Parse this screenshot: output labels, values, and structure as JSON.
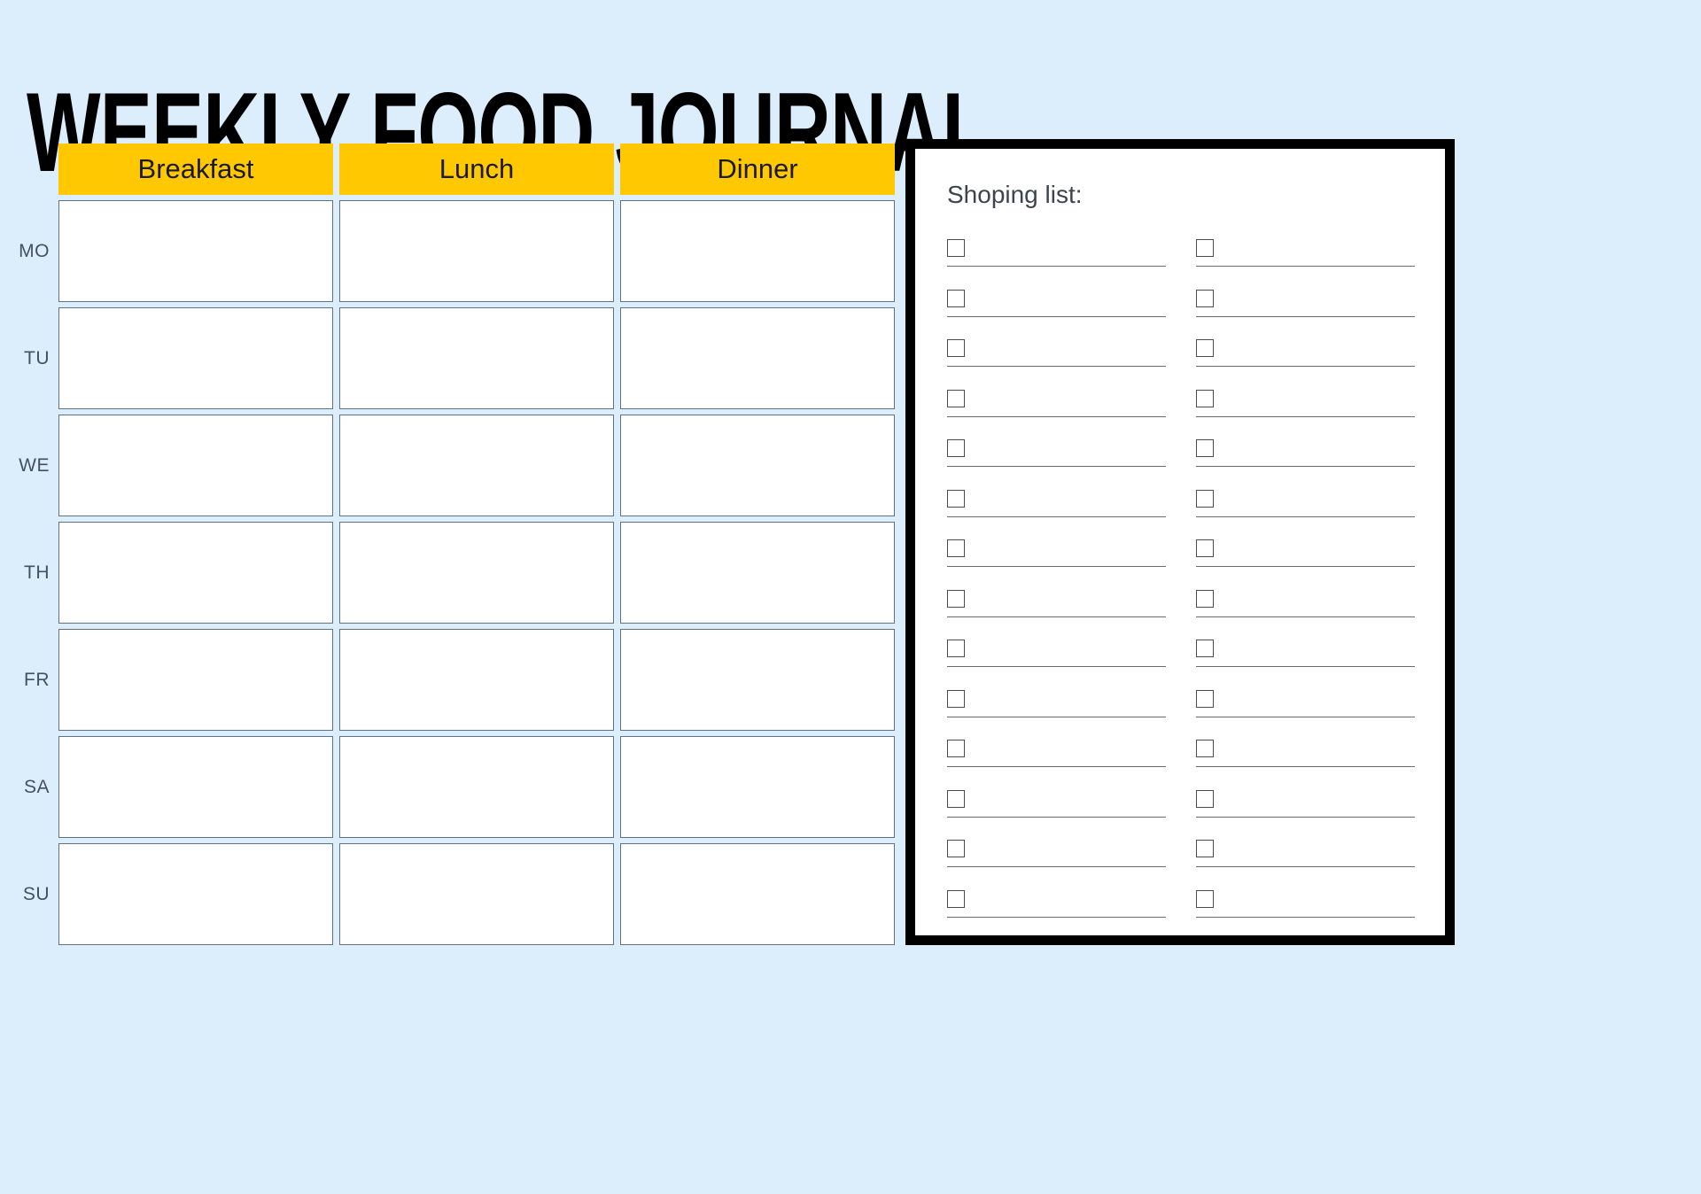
{
  "page": {
    "title": "WEEKLY FOOD JOURNAL",
    "background_color": "#dceefc"
  },
  "planner": {
    "accent_color": "#ffc800",
    "cell_border_color": "#5d7286",
    "day_label_color": "#44505e",
    "columns": [
      {
        "label": "Breakfast"
      },
      {
        "label": "Lunch"
      },
      {
        "label": "Dinner"
      }
    ],
    "days": [
      {
        "label": "MO",
        "cells": [
          "",
          "",
          ""
        ]
      },
      {
        "label": "TU",
        "cells": [
          "",
          "",
          ""
        ]
      },
      {
        "label": "WE",
        "cells": [
          "",
          "",
          ""
        ]
      },
      {
        "label": "TH",
        "cells": [
          "",
          "",
          ""
        ]
      },
      {
        "label": "FR",
        "cells": [
          "",
          "",
          ""
        ]
      },
      {
        "label": "SA",
        "cells": [
          "",
          "",
          ""
        ]
      },
      {
        "label": "SU",
        "cells": [
          "",
          "",
          ""
        ]
      }
    ]
  },
  "shopping": {
    "title": "Shoping list:",
    "border_color": "#000000",
    "checkbox_icon": "checkbox-empty-icon",
    "columns": [
      {
        "name": "left",
        "rows": [
          {
            "checked": false,
            "value": ""
          },
          {
            "checked": false,
            "value": ""
          },
          {
            "checked": false,
            "value": ""
          },
          {
            "checked": false,
            "value": ""
          },
          {
            "checked": false,
            "value": ""
          },
          {
            "checked": false,
            "value": ""
          },
          {
            "checked": false,
            "value": ""
          },
          {
            "checked": false,
            "value": ""
          },
          {
            "checked": false,
            "value": ""
          },
          {
            "checked": false,
            "value": ""
          },
          {
            "checked": false,
            "value": ""
          },
          {
            "checked": false,
            "value": ""
          },
          {
            "checked": false,
            "value": ""
          },
          {
            "checked": false,
            "value": ""
          }
        ]
      },
      {
        "name": "right",
        "rows": [
          {
            "checked": false,
            "value": ""
          },
          {
            "checked": false,
            "value": ""
          },
          {
            "checked": false,
            "value": ""
          },
          {
            "checked": false,
            "value": ""
          },
          {
            "checked": false,
            "value": ""
          },
          {
            "checked": false,
            "value": ""
          },
          {
            "checked": false,
            "value": ""
          },
          {
            "checked": false,
            "value": ""
          },
          {
            "checked": false,
            "value": ""
          },
          {
            "checked": false,
            "value": ""
          },
          {
            "checked": false,
            "value": ""
          },
          {
            "checked": false,
            "value": ""
          },
          {
            "checked": false,
            "value": ""
          },
          {
            "checked": false,
            "value": ""
          }
        ]
      }
    ]
  }
}
